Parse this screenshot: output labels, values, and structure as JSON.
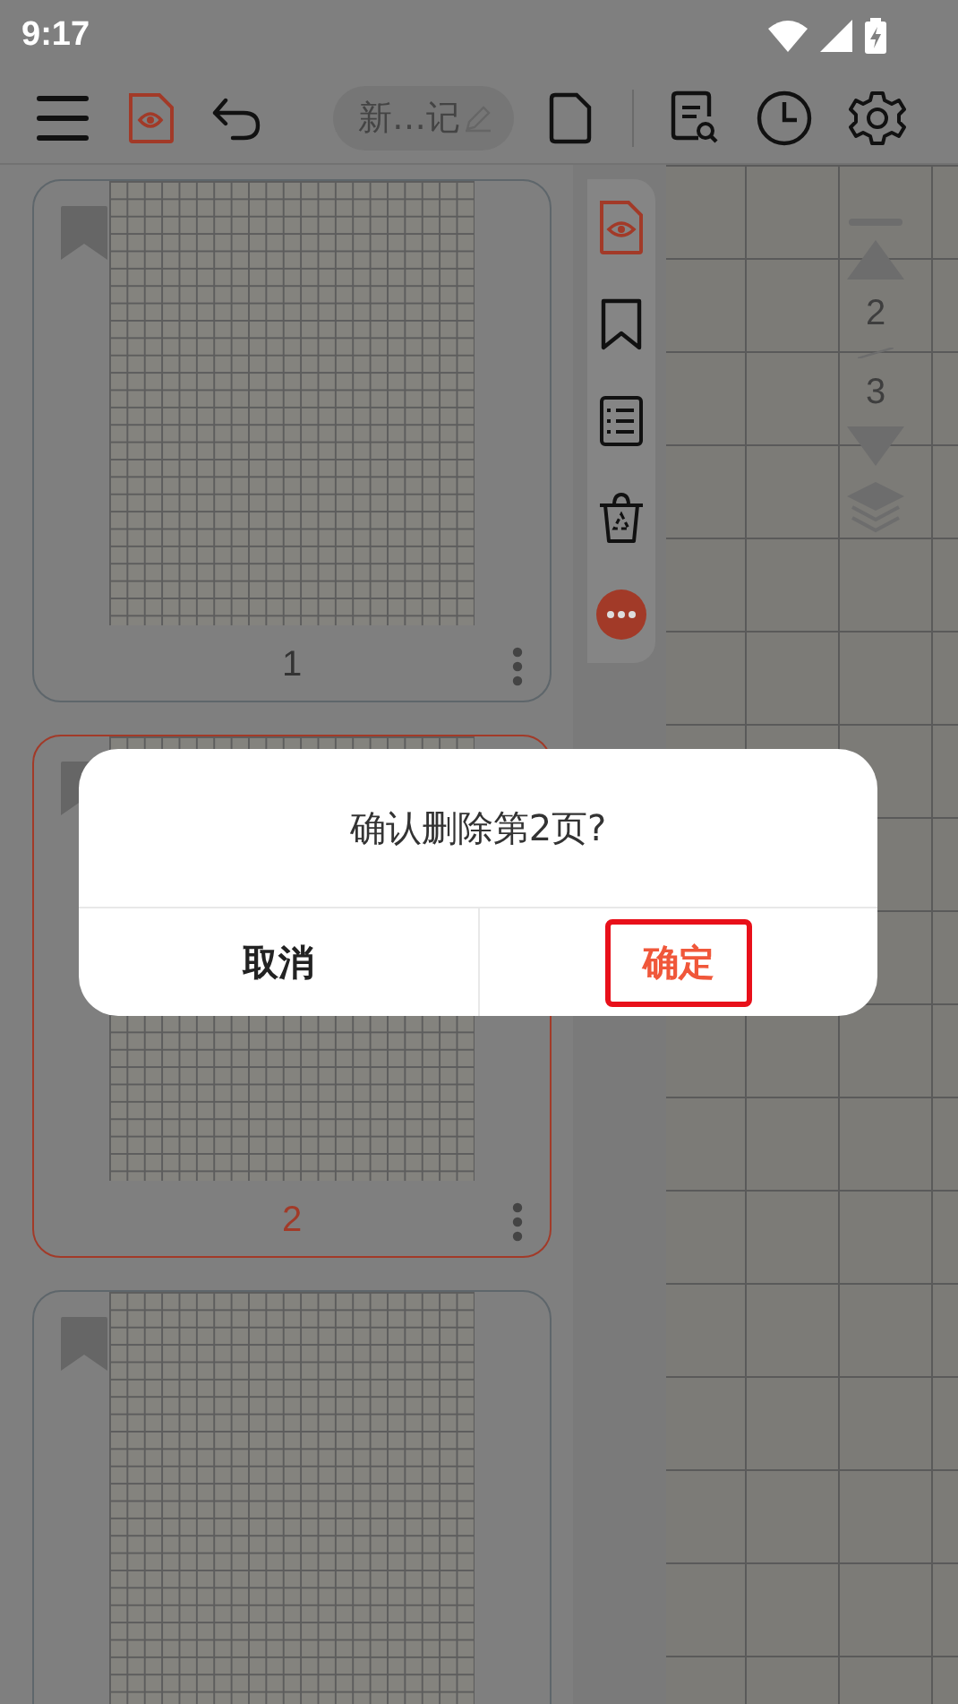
{
  "status_bar": {
    "time": "9:17"
  },
  "toolbar": {
    "title": "新…记"
  },
  "pages": [
    {
      "number": "1",
      "selected": false
    },
    {
      "number": "2",
      "selected": true
    },
    {
      "selected": false
    }
  ],
  "page_nav": {
    "current": "2",
    "total": "3"
  },
  "dialog": {
    "message": "确认删除第2页?",
    "buttons": [
      {
        "label": "取消",
        "kind": "cancel",
        "highlighted": false
      },
      {
        "label": "确定",
        "kind": "confirm",
        "highlighted": true
      }
    ]
  }
}
